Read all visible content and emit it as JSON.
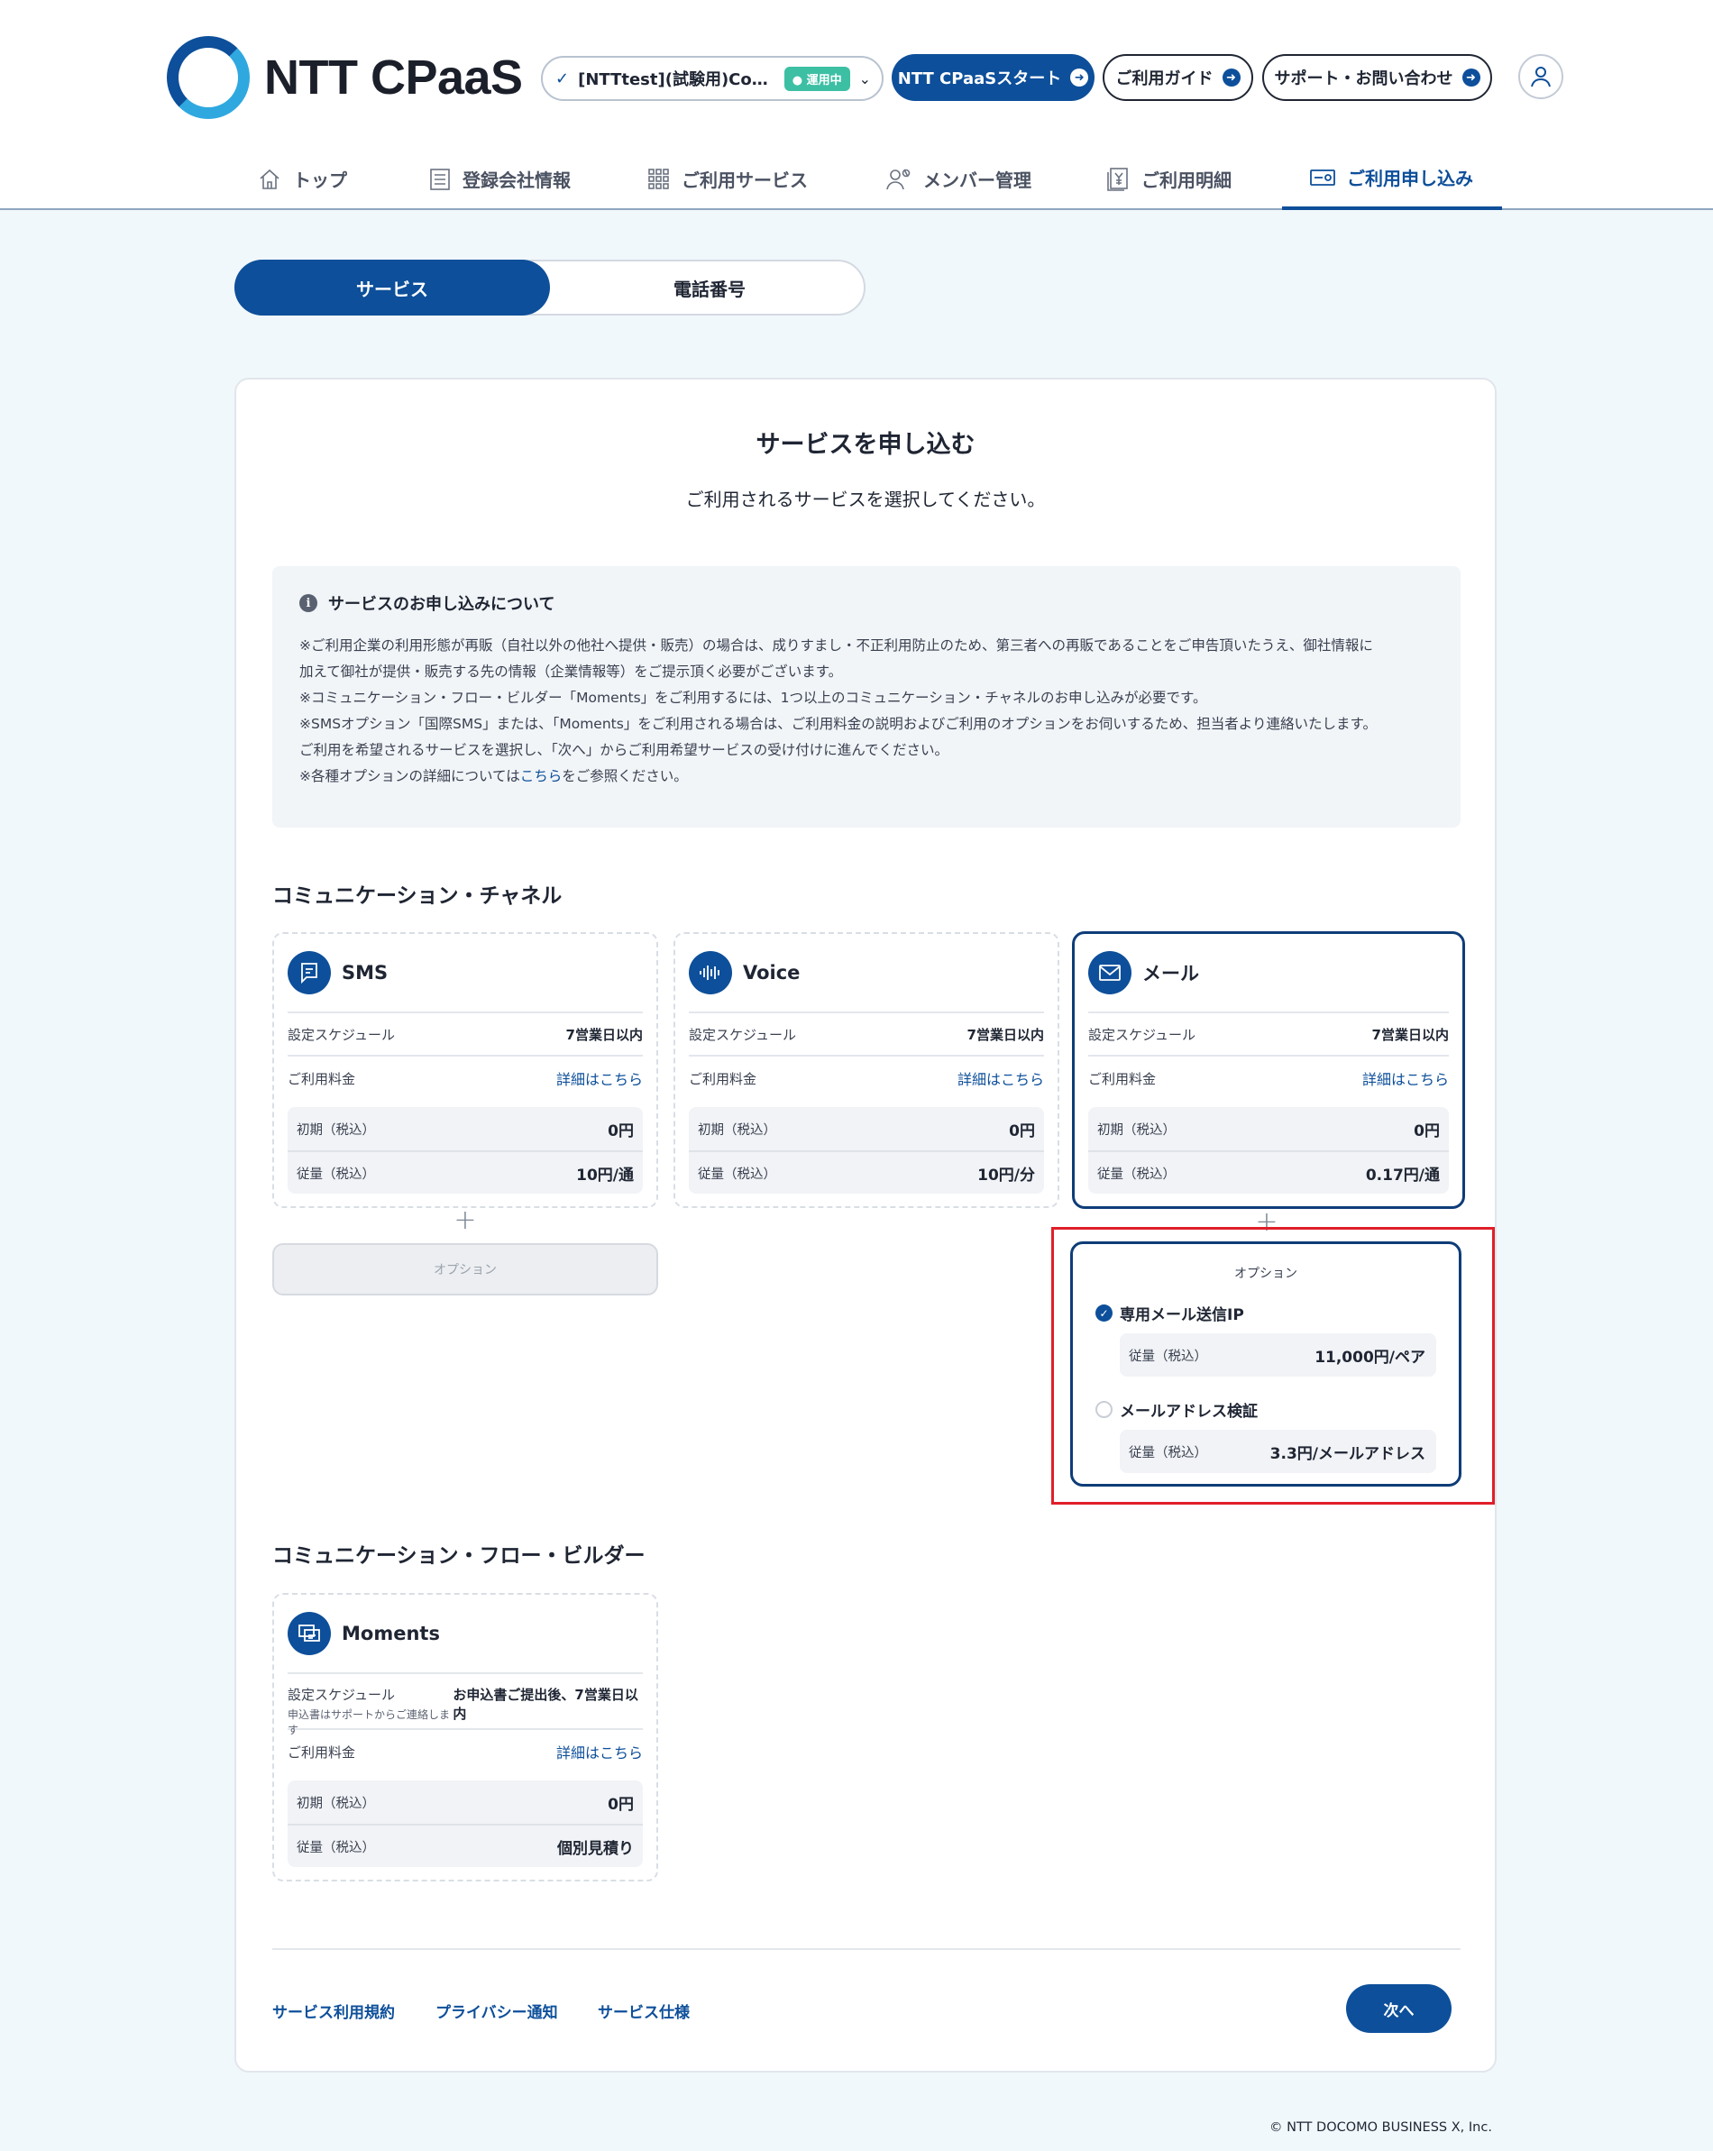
{
  "header": {
    "logo_text": "NTT CPaaS",
    "account": {
      "name": "[NTTtest](試験用)Com…",
      "status_badge": "運用中"
    },
    "start_button": "NTT CPaaSスタート",
    "guide_button": "ご利用ガイド",
    "support_button": "サポート・お問い合わせ"
  },
  "nav": {
    "items": [
      {
        "label": "トップ",
        "icon": "home-icon"
      },
      {
        "label": "登録会社情報",
        "icon": "document-icon"
      },
      {
        "label": "ご利用サービス",
        "icon": "grid-icon"
      },
      {
        "label": "メンバー管理",
        "icon": "members-icon"
      },
      {
        "label": "ご利用明細",
        "icon": "receipt-icon"
      },
      {
        "label": "ご利用申し込み",
        "icon": "application-icon",
        "active": true
      }
    ]
  },
  "toggle": {
    "service": "サービス",
    "phone": "電話番号"
  },
  "page": {
    "title": "サービスを申し込む",
    "subtitle": "ご利用されるサービスを選択してください。"
  },
  "notice": {
    "title": "サービスのお申し込みについて",
    "line1": "※ご利用企業の利用形態が再販（自社以外の他社へ提供・販売）の場合は、成りすまし・不正利用防止のため、第三者への再販であることをご申告頂いたうえ、御社情報に",
    "line2": "加えて御社が提供・販売する先の情報（企業情報等）をご提示頂く必要がございます。",
    "line3": "※コミュニケーション・フロー・ビルダー「Moments」をご利用するには、1つ以上のコミュニケーション・チャネルのお申し込みが必要です。",
    "line4": "※SMSオプション「国際SMS」または、「Moments」をご利用される場合は、ご利用料金の説明およびご利用のオプションをお伺いするため、担当者より連絡いたします。",
    "line5": "ご利用を希望されるサービスを選択し、「次へ」からご利用希望サービスの受け付けに進んでください。",
    "line6_pre": "※各種オプションの詳細については",
    "line6_link": "こちら",
    "line6_post": "をご参照ください。"
  },
  "channels": {
    "heading": "コミュニケーション・チャネル",
    "sms": {
      "name": "SMS",
      "schedule_label": "設定スケジュール",
      "schedule": "7営業日以内",
      "fee_label": "ご利用料金",
      "fee_link": "詳細はこちら",
      "initial_label": "初期（税込）",
      "initial": "0円",
      "usage_label": "従量（税込）",
      "usage": "10円/通"
    },
    "voice": {
      "name": "Voice",
      "schedule_label": "設定スケジュール",
      "schedule": "7営業日以内",
      "fee_label": "ご利用料金",
      "fee_link": "詳細はこちら",
      "initial_label": "初期（税込）",
      "initial": "0円",
      "usage_label": "従量（税込）",
      "usage": "10円/分"
    },
    "mail": {
      "name": "メール",
      "schedule_label": "設定スケジュール",
      "schedule": "7営業日以内",
      "fee_label": "ご利用料金",
      "fee_link": "詳細はこちら",
      "initial_label": "初期（税込）",
      "initial": "0円",
      "usage_label": "従量（税込）",
      "usage": "0.17円/通"
    }
  },
  "sms_option": {
    "label": "オプション"
  },
  "mail_options": {
    "title": "オプション",
    "items": [
      {
        "label": "専用メール送信IP",
        "checked": true,
        "fee_label": "従量（税込）",
        "fee": "11,000円/ペア"
      },
      {
        "label": "メールアドレス検証",
        "checked": false,
        "fee_label": "従量（税込）",
        "fee": "3.3円/メールアドレス"
      }
    ]
  },
  "flow_builder": {
    "heading": "コミュニケーション・フロー・ビルダー",
    "moments": {
      "name": "Moments",
      "schedule_label": "設定スケジュール",
      "schedule": "お申込書ご提出後、7営業日以内",
      "schedule_note": "申込書はサポートからご連絡します",
      "fee_label": "ご利用料金",
      "fee_link": "詳細はこちら",
      "initial_label": "初期（税込）",
      "initial": "0円",
      "usage_label": "従量（税込）",
      "usage": "個別見積り"
    }
  },
  "footer": {
    "terms": "サービス利用規約",
    "privacy": "プライバシー通知",
    "spec": "サービス仕様",
    "next": "次へ",
    "copyright": "© NTT DOCOMO BUSINESS X, Inc."
  },
  "colors": {
    "primary": "#0d4f9a",
    "badge": "#3dbfa4",
    "highlight": "#e01f2a",
    "background": "#f1f8fb"
  }
}
